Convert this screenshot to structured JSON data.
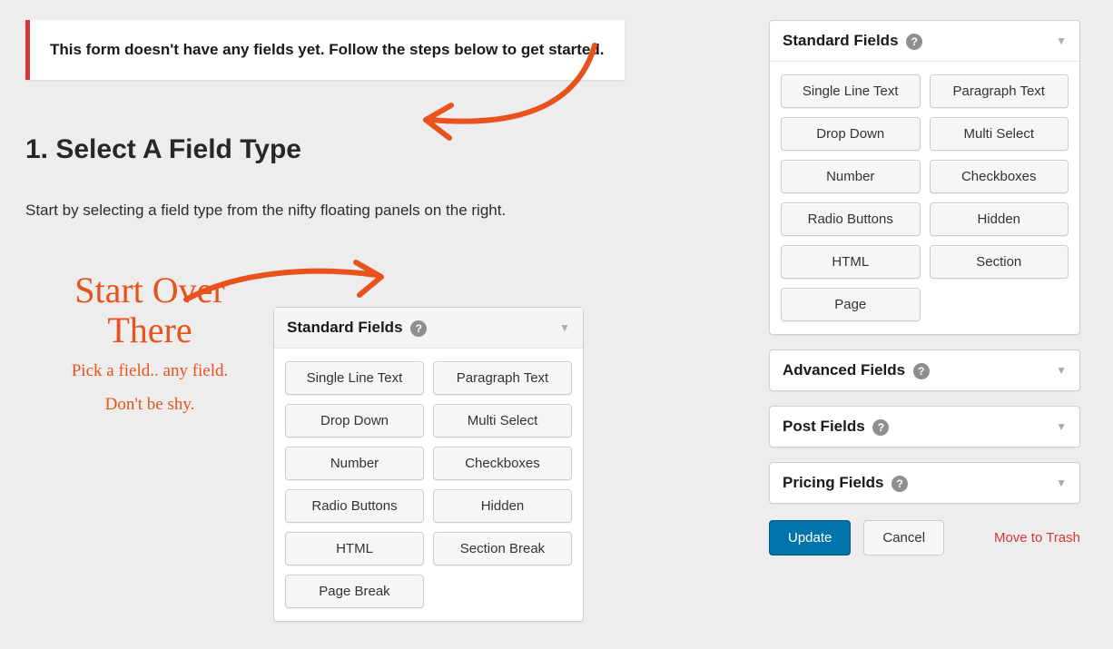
{
  "notice": "This form doesn't have any fields yet. Follow the steps below to get started.",
  "heading": "1. Select A Field Type",
  "intro": "Start by selecting a field type from the nifty floating panels on the right.",
  "hand": {
    "big1": "Start Over",
    "big2": "There",
    "small1": "Pick a field.. any field.",
    "small2": "Don't be shy."
  },
  "example_panel": {
    "title": "Standard Fields",
    "buttons": [
      "Single Line Text",
      "Paragraph Text",
      "Drop Down",
      "Multi Select",
      "Number",
      "Checkboxes",
      "Radio Buttons",
      "Hidden",
      "HTML",
      "Section Break",
      "Page Break"
    ]
  },
  "sidebar": {
    "standard": {
      "title": "Standard Fields",
      "buttons": [
        "Single Line Text",
        "Paragraph Text",
        "Drop Down",
        "Multi Select",
        "Number",
        "Checkboxes",
        "Radio Buttons",
        "Hidden",
        "HTML",
        "Section",
        "Page"
      ]
    },
    "advanced": {
      "title": "Advanced Fields"
    },
    "post": {
      "title": "Post Fields"
    },
    "pricing": {
      "title": "Pricing Fields"
    }
  },
  "actions": {
    "update": "Update",
    "cancel": "Cancel",
    "trash": "Move to Trash"
  }
}
